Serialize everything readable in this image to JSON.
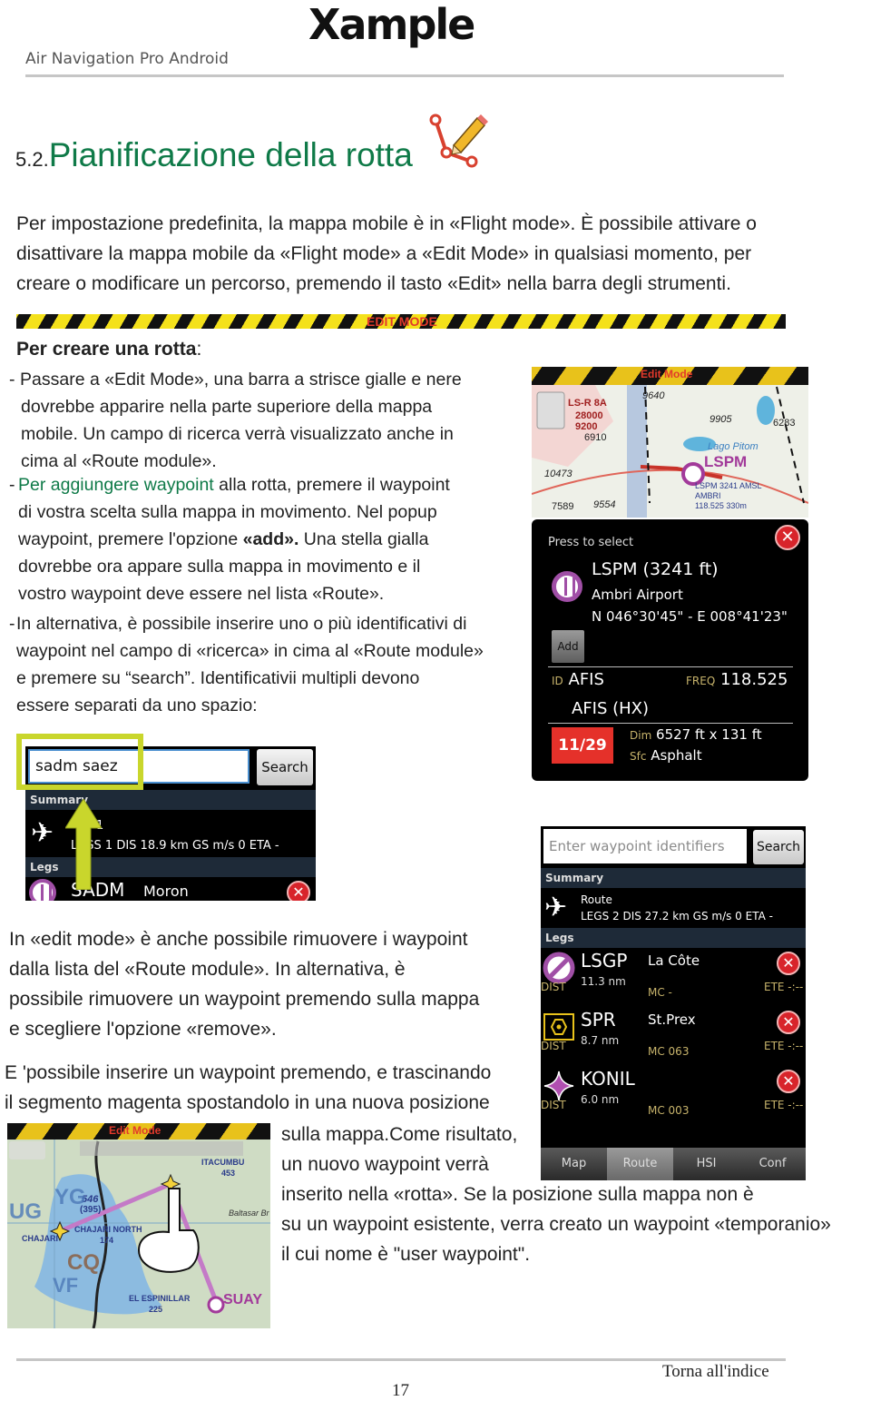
{
  "header": {
    "logo": "Xample",
    "subtitle": "Air Navigation Pro Android"
  },
  "section": {
    "number": "5.2.",
    "title": "Pianificazione della rotta"
  },
  "intro": [
    "Per impostazione predefinita, la mappa mobile è in «Flight mode». È possibile attivare o",
    "disattivare la mappa mobile da «Flight mode» a «Edit Mode» in qualsiasi momento, per",
    "creare o modificare un percorso, premendo il tasto «Edit» nella barra degli strumenti."
  ],
  "edit_mode_bar": {
    "label": "EDIT MODE"
  },
  "howto": {
    "title": "Per creare una rotta",
    "title_suffix": ":",
    "step1": [
      "Passare a «Edit Mode», una barra a strisce gialle e nere",
      "dovrebbe apparire nella parte superiore della mappa",
      "mobile. Un campo di ricerca verrà visualizzato anche in",
      "cima al «Route module»."
    ],
    "step2_highlight": "Per aggiungere waypoint",
    "step2_line1_rest": " alla rotta, premere il waypoint",
    "step2": [
      "di vostra scelta sulla mappa in movimento. Nel popup"
    ],
    "step2_line3_pre": "waypoint, premere l'opzione ",
    "step2_line3_bold": "«add».",
    "step2_line3_post": " Una stella gialla",
    "step2_rest": [
      "dovrebbe ora appare sulla mappa in movimento e il",
      "vostro waypoint deve essere nel  lista «Route»."
    ],
    "step3": [
      "In alternativa, è possibile inserire uno o più identificativi di",
      "waypoint nel campo di «ricerca» in cima al «Route module»",
      "e premere su “search”. Identificativii multipli devono",
      "essere separati da uno spazio:"
    ],
    "dash": "-"
  },
  "map_screenshot_1": {
    "banner": "Edit Mode",
    "labels": [
      "LS-R 8A",
      "28000",
      "9200",
      "9640",
      "9905",
      "6283",
      "6910",
      "Lago Pitom",
      "10473",
      "7589",
      "9554",
      "LSPM 3241 AMSL",
      "AMBRI",
      "118.525  330m"
    ],
    "airport": "LSPM"
  },
  "waypoint_popup": {
    "hint": "Press to select",
    "name": "LSPM (3241 ft)",
    "full_name": "Ambri Airport",
    "coordinates": "N 046°30'45\" - E 008°41'23\"",
    "add_label": "Add",
    "id_label": "ID",
    "id_value": "AFIS",
    "freq_label": "FREQ",
    "freq_value": "118.525",
    "service": "AFIS (HX)",
    "runway": "11/29",
    "dim_label": "Dim",
    "dim_value": "6527 ft x 131 ft",
    "sfc_label": "Sfc",
    "sfc_value": "Asphalt"
  },
  "search_screenshot": {
    "input_value": "sadm saez",
    "search_label": "Search",
    "summary_label": "Summary",
    "summary_line1": "1",
    "summary_line2": "LEGS 1  DIS 18.9 km  GS m/s 0  ETA -",
    "legs_label": "Legs",
    "leg_code": "SADM",
    "leg_name": "Moron"
  },
  "route_screenshot": {
    "input_placeholder": "Enter waypoint identifiers",
    "search_label": "Search",
    "summary_label": "Summary",
    "route_label": "Route",
    "route_stats": "LEGS 2  DIS 27.2 km  GS m/s 0  ETA -",
    "legs_label": "Legs",
    "legs": [
      {
        "code": "LSGP",
        "name": "La Côte",
        "dist_label": "DIST",
        "dist": "11.3 nm",
        "mc": "MC -",
        "ete": "ETE -:--"
      },
      {
        "code": "SPR",
        "name": "St.Prex",
        "dist_label": "DIST",
        "dist": "8.7 nm",
        "mc": "MC 063",
        "ete": "ETE -:--"
      },
      {
        "code": "KONIL",
        "name": "",
        "dist_label": "DIST",
        "dist": "6.0 nm",
        "mc": "MC 003",
        "ete": "ETE -:--"
      }
    ],
    "tabs": [
      {
        "label": "Map",
        "active": false
      },
      {
        "label": "Route",
        "active": true
      },
      {
        "label": "HSI",
        "active": false
      },
      {
        "label": "Conf",
        "active": false
      }
    ]
  },
  "remove_text": [
    "In «edit mode» è anche possibile rimuovere i waypoint",
    "dalla lista del «Route module». In alternativa, è",
    "possibile rimuovere un waypoint premendo sulla mappa",
    "e scegliere l'opzione «remove»."
  ],
  "drag_text": [
    "E 'possibile inserire un waypoint premendo, e trascinando",
    "il segmento magenta spostandolo in una nuova posizione"
  ],
  "result_text": [
    "sulla mappa.Come risultato,",
    "un nuovo waypoint verrà",
    "inserito nella «rotta». Se la posizione sulla mappa non è",
    "su un waypoint esistente, verra creato un waypoint «temporanio»",
    "il cui nome è \"user waypoint\"."
  ],
  "map_screenshot_2": {
    "banner": "Edit Mode",
    "labels": [
      "ITACUMBU",
      "453",
      "546",
      "(395)",
      "CHAJARI",
      "CHAJARI NORTH",
      "174",
      "Baltasar Br",
      "YG",
      "UG",
      "CQ",
      "VF",
      "EL ESPINILLAR",
      "225"
    ],
    "airport": "SUAY"
  },
  "footer": {
    "toc_link": "Torna all'indice",
    "page": "17"
  }
}
